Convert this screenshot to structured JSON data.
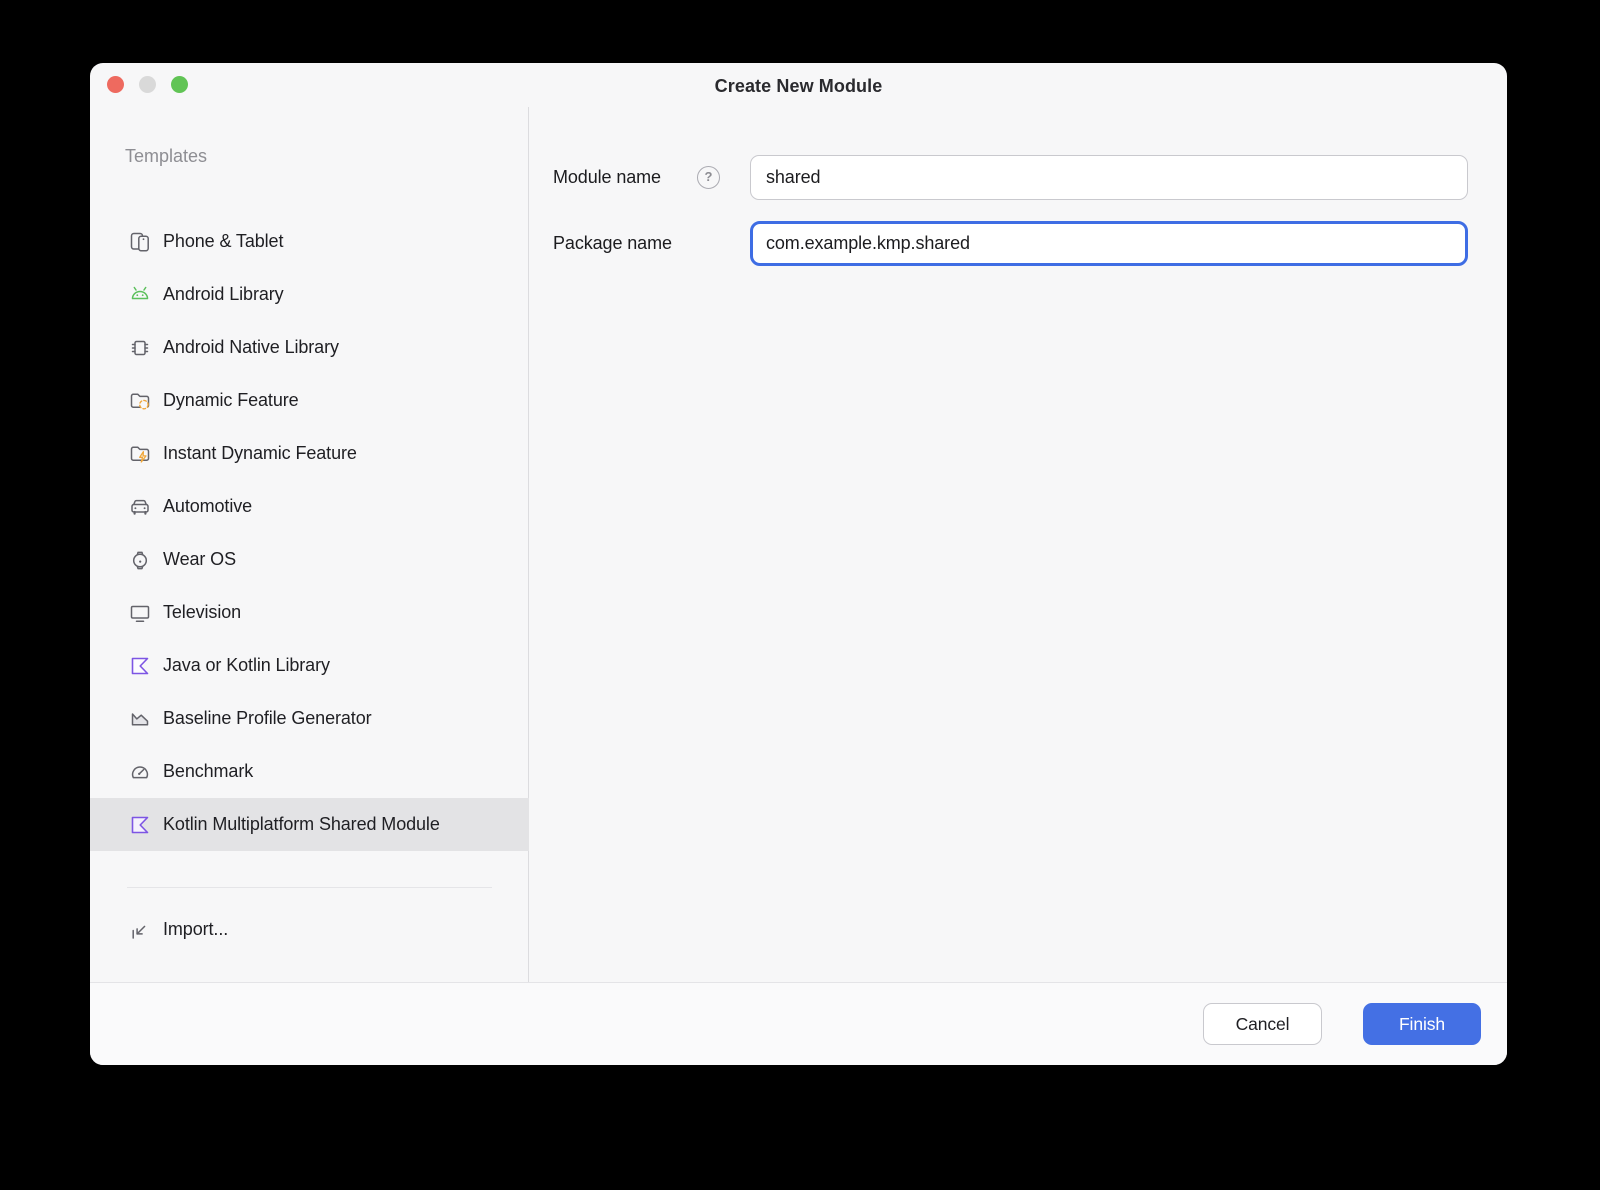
{
  "window": {
    "title": "Create New Module"
  },
  "window_controls": {
    "close_color": "#ee6a5f",
    "minimize_color": "#d9d9d9",
    "zoom_color": "#61c455"
  },
  "sidebar": {
    "header": "Templates",
    "items": [
      {
        "label": "Phone & Tablet",
        "icon": "phone-tablet-icon"
      },
      {
        "label": "Android Library",
        "icon": "android-icon"
      },
      {
        "label": "Android Native Library",
        "icon": "chip-icon"
      },
      {
        "label": "Dynamic Feature",
        "icon": "folder-dashed-circle-icon"
      },
      {
        "label": "Instant Dynamic Feature",
        "icon": "folder-lightning-icon"
      },
      {
        "label": "Automotive",
        "icon": "car-icon"
      },
      {
        "label": "Wear OS",
        "icon": "watch-icon"
      },
      {
        "label": "Television",
        "icon": "tv-icon"
      },
      {
        "label": "Java or Kotlin Library",
        "icon": "kotlin-icon"
      },
      {
        "label": "Baseline Profile Generator",
        "icon": "area-chart-icon"
      },
      {
        "label": "Benchmark",
        "icon": "gauge-icon"
      },
      {
        "label": "Kotlin Multiplatform Shared Module",
        "icon": "kotlin-icon",
        "selected": true
      }
    ],
    "import_label": "Import..."
  },
  "form": {
    "module_name": {
      "label": "Module name",
      "value": "shared",
      "help_icon": "?"
    },
    "package_name": {
      "label": "Package name",
      "value": "com.example.kmp.shared",
      "focused": true
    }
  },
  "footer": {
    "cancel_label": "Cancel",
    "finish_label": "Finish"
  },
  "colors": {
    "accent_blue": "#4470e4",
    "focus_border": "#3e6de4",
    "selected_row": "#e3e3e5",
    "kotlin_purple": "#7d55e4",
    "android_green": "#5cc05c",
    "feature_orange": "#f0a73a",
    "icon_gray": "#63636a",
    "window_bg": "#f7f7f8"
  }
}
